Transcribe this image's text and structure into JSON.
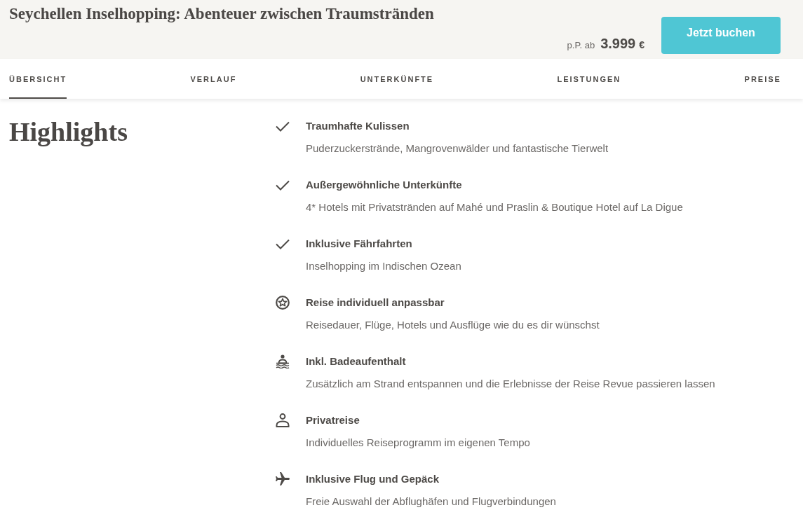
{
  "header": {
    "title": "Seychellen Inselhopping: Abenteuer zwischen Traumstränden",
    "price": {
      "prefix": "p.P. ab",
      "amount": "3.999",
      "currency": "€"
    },
    "book_button": "Jetzt buchen"
  },
  "tabs": [
    {
      "label": "ÜBERSICHT",
      "selected": true
    },
    {
      "label": "VERLAUF",
      "selected": false
    },
    {
      "label": "UNTERKÜNFTE",
      "selected": false
    },
    {
      "label": "LEISTUNGEN",
      "selected": false
    },
    {
      "label": "PREISE",
      "selected": false
    }
  ],
  "highlights": {
    "heading": "Highlights",
    "items": [
      {
        "kind": "check",
        "title": "Traumhafte Kulissen",
        "description": "Puderzuckerstrände, Mangrovenwälder und fantastische Tierwelt"
      },
      {
        "kind": "check",
        "title": "Außergewöhnliche Unterkünfte",
        "description": "4* Hotels mit Privatstränden auf Mahé und Praslin & Boutique Hotel auf La Digue"
      },
      {
        "kind": "check",
        "title": "Inklusive Fährfahrten",
        "description": "Inselhopping im Indischen Ozean"
      },
      {
        "kind": "custom",
        "title": "Reise individuell anpassbar",
        "description": "Reisedauer, Flüge, Hotels und Ausflüge wie du es dir wünschst"
      },
      {
        "kind": "beach",
        "title": "Inkl. Badeaufenthalt",
        "description": "Zusätzlich am Strand entspannen und die Erlebnisse der Reise Revue passieren lassen"
      },
      {
        "kind": "private",
        "title": "Privatreise",
        "description": "Individuelles Reiseprogramm im eigenen Tempo"
      },
      {
        "kind": "flight",
        "title": "Inklusive Flug und Gepäck",
        "description": "Freie Auswahl der Abflughäfen und Flugverbindungen"
      }
    ]
  }
}
